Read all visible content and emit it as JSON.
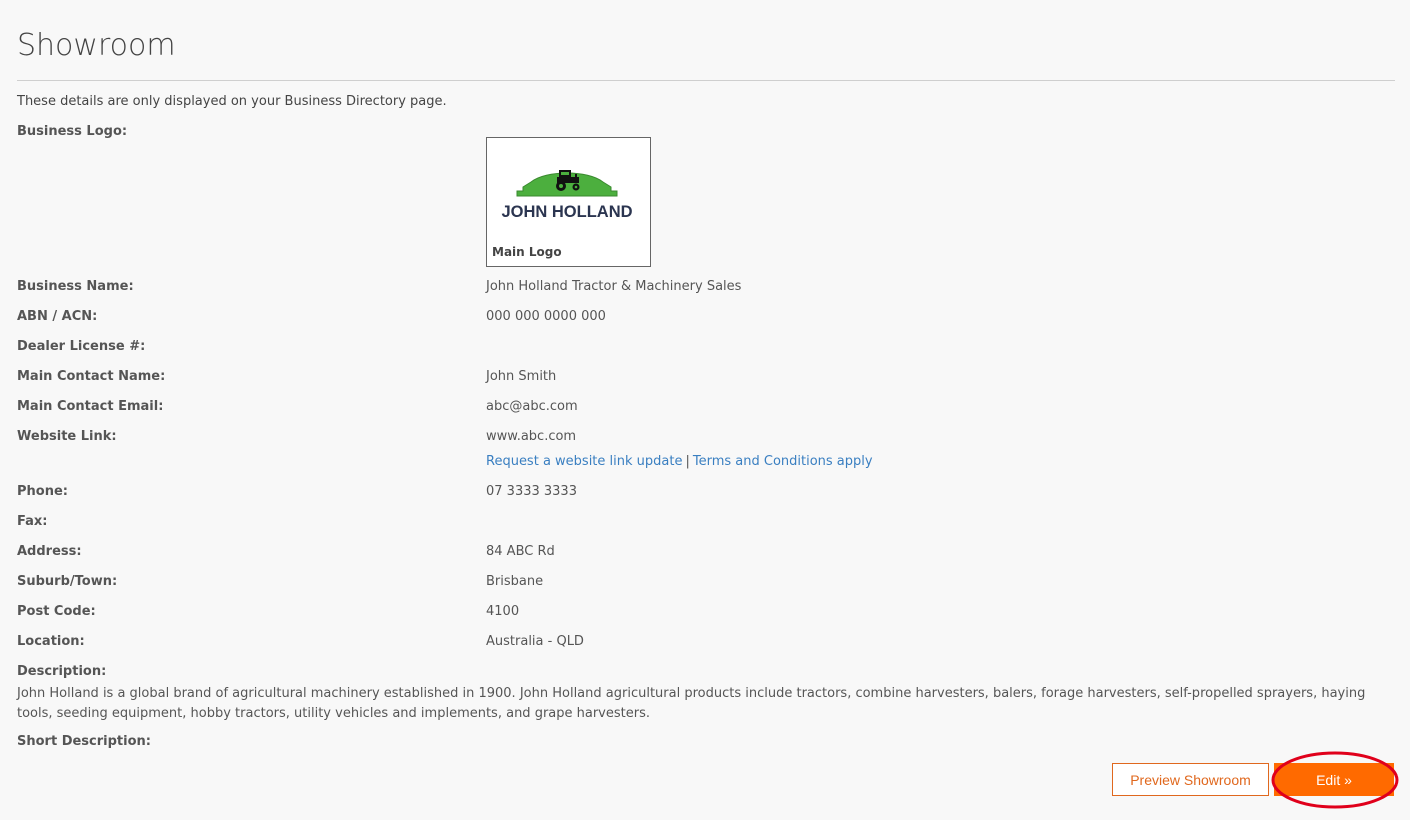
{
  "page": {
    "title": "Showroom",
    "intro": "These details are only displayed on your Business Directory page."
  },
  "logo": {
    "label": "Business Logo:",
    "brand_text": "JOHN HOLLAND",
    "caption": "Main Logo"
  },
  "fields": {
    "business_name": {
      "label": "Business Name:",
      "value": "John Holland Tractor & Machinery Sales"
    },
    "abn": {
      "label": "ABN / ACN:",
      "value": "000 000 0000 000"
    },
    "dealer_license": {
      "label": "Dealer License #:",
      "value": ""
    },
    "contact_name": {
      "label": "Main Contact Name:",
      "value": "John Smith"
    },
    "contact_email": {
      "label": "Main Contact Email:",
      "value": "abc@abc.com"
    },
    "website": {
      "label": "Website Link:",
      "value": "www.abc.com",
      "update_link": "Request a website link update",
      "separator": "|",
      "terms_link": "Terms and Conditions apply"
    },
    "phone": {
      "label": "Phone:",
      "value": "07 3333 3333"
    },
    "fax": {
      "label": "Fax:",
      "value": ""
    },
    "address": {
      "label": "Address:",
      "value": "84 ABC Rd"
    },
    "suburb": {
      "label": "Suburb/Town:",
      "value": "Brisbane"
    },
    "postcode": {
      "label": "Post Code:",
      "value": "4100"
    },
    "location": {
      "label": "Location:",
      "value": "Australia - QLD"
    },
    "description": {
      "label": "Description:",
      "value": "John Holland is a global brand of agricultural machinery established in 1900. John Holland agricultural products include tractors, combine harvesters, balers, forage harvesters, self-propelled sprayers, haying tools, seeding equipment, hobby tractors, utility vehicles and implements, and grape harvesters."
    },
    "short_description": {
      "label": "Short Description:",
      "value": ""
    }
  },
  "actions": {
    "preview_label": "Preview Showroom",
    "edit_label": "Edit »"
  },
  "colors": {
    "accent": "#ff6a00",
    "link": "#3a7fc1",
    "logo_green": "#4caf3e",
    "logo_text": "#2b3550",
    "highlight": "#e0001b"
  },
  "icons": {
    "logo_mark": "tractor-icon"
  }
}
